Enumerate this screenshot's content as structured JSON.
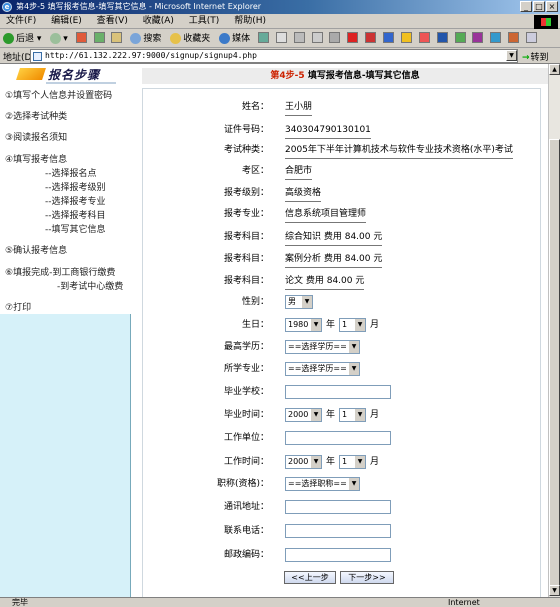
{
  "window": {
    "title": "第4步-5 填写报考信息-填写其它信息 - Microsoft Internet Explorer",
    "controls": [
      "_",
      "□",
      "×"
    ]
  },
  "menubar": {
    "items": [
      "文件(F)",
      "编辑(E)",
      "查看(V)",
      "收藏(A)",
      "工具(T)",
      "帮助(H)"
    ]
  },
  "toolbar": {
    "back": "后退",
    "search": "搜索",
    "favorites": "收藏夹",
    "media": "媒体"
  },
  "address": {
    "label": "地址(D)",
    "url": "http://61.132.222.97:9000/signup/signup4.php",
    "go": "转到"
  },
  "sidebar": {
    "header": "报名步骤",
    "items": [
      "①填写个人信息并设置密码",
      "②选择考试种类",
      "③阅读报名须知",
      "④填写报考信息",
      "⑤确认报考信息",
      "⑥填报完成-到工商银行缴费",
      "-到考试中心缴费",
      "⑦打印"
    ],
    "subitems": [
      "--选择报名点",
      "--选择报考级别",
      "--选择报考专业",
      "--选择报考科目",
      "--填写其它信息"
    ]
  },
  "form": {
    "step": "第4步-5",
    "title": "填写报考信息-填写其它信息",
    "name_label": "姓名：",
    "name": "王小朋",
    "id_label": "证件号码：",
    "id": "340304790130101",
    "exam_type_label": "考试种类：",
    "exam_type": "2005年下半年计算机技术与软件专业技术资格(水平)考试",
    "region_label": "考区：",
    "region": "合肥市",
    "level_label": "报考级别：",
    "level": "高级资格",
    "major_label": "报考专业：",
    "major": "信息系统项目管理师",
    "subjects_label": "报考科目：",
    "subjects": [
      "综合知识 费用 84.00 元",
      "案例分析 费用 84.00 元",
      "论文 费用 84.00 元"
    ],
    "gender_label": "性别：",
    "gender": "男",
    "birthday_label": "生日：",
    "birth_year": "1980",
    "birth_month": "1",
    "year_unit": "年",
    "month_unit": "月",
    "education_label": "最高学历：",
    "education": "==选择学历==",
    "education2_label": "所学专业：",
    "education2": "==选择学历==",
    "school_label": "毕业学校：",
    "grad_time_label": "毕业时间：",
    "grad_year": "2000",
    "grad_month": "1",
    "work_unit_label": "工作单位：",
    "work_time_label": "工作时间：",
    "work_year": "2000",
    "work_month": "1",
    "title_label": "职称(资格)：",
    "title_select": "==选择职称==",
    "address_label": "通讯地址：",
    "phone_label": "联系电话：",
    "zip_label": "邮政编码：",
    "prev_button": "<<上一步",
    "next_button": "下一步>>"
  },
  "status": {
    "left": "完毕",
    "right": "Internet"
  }
}
